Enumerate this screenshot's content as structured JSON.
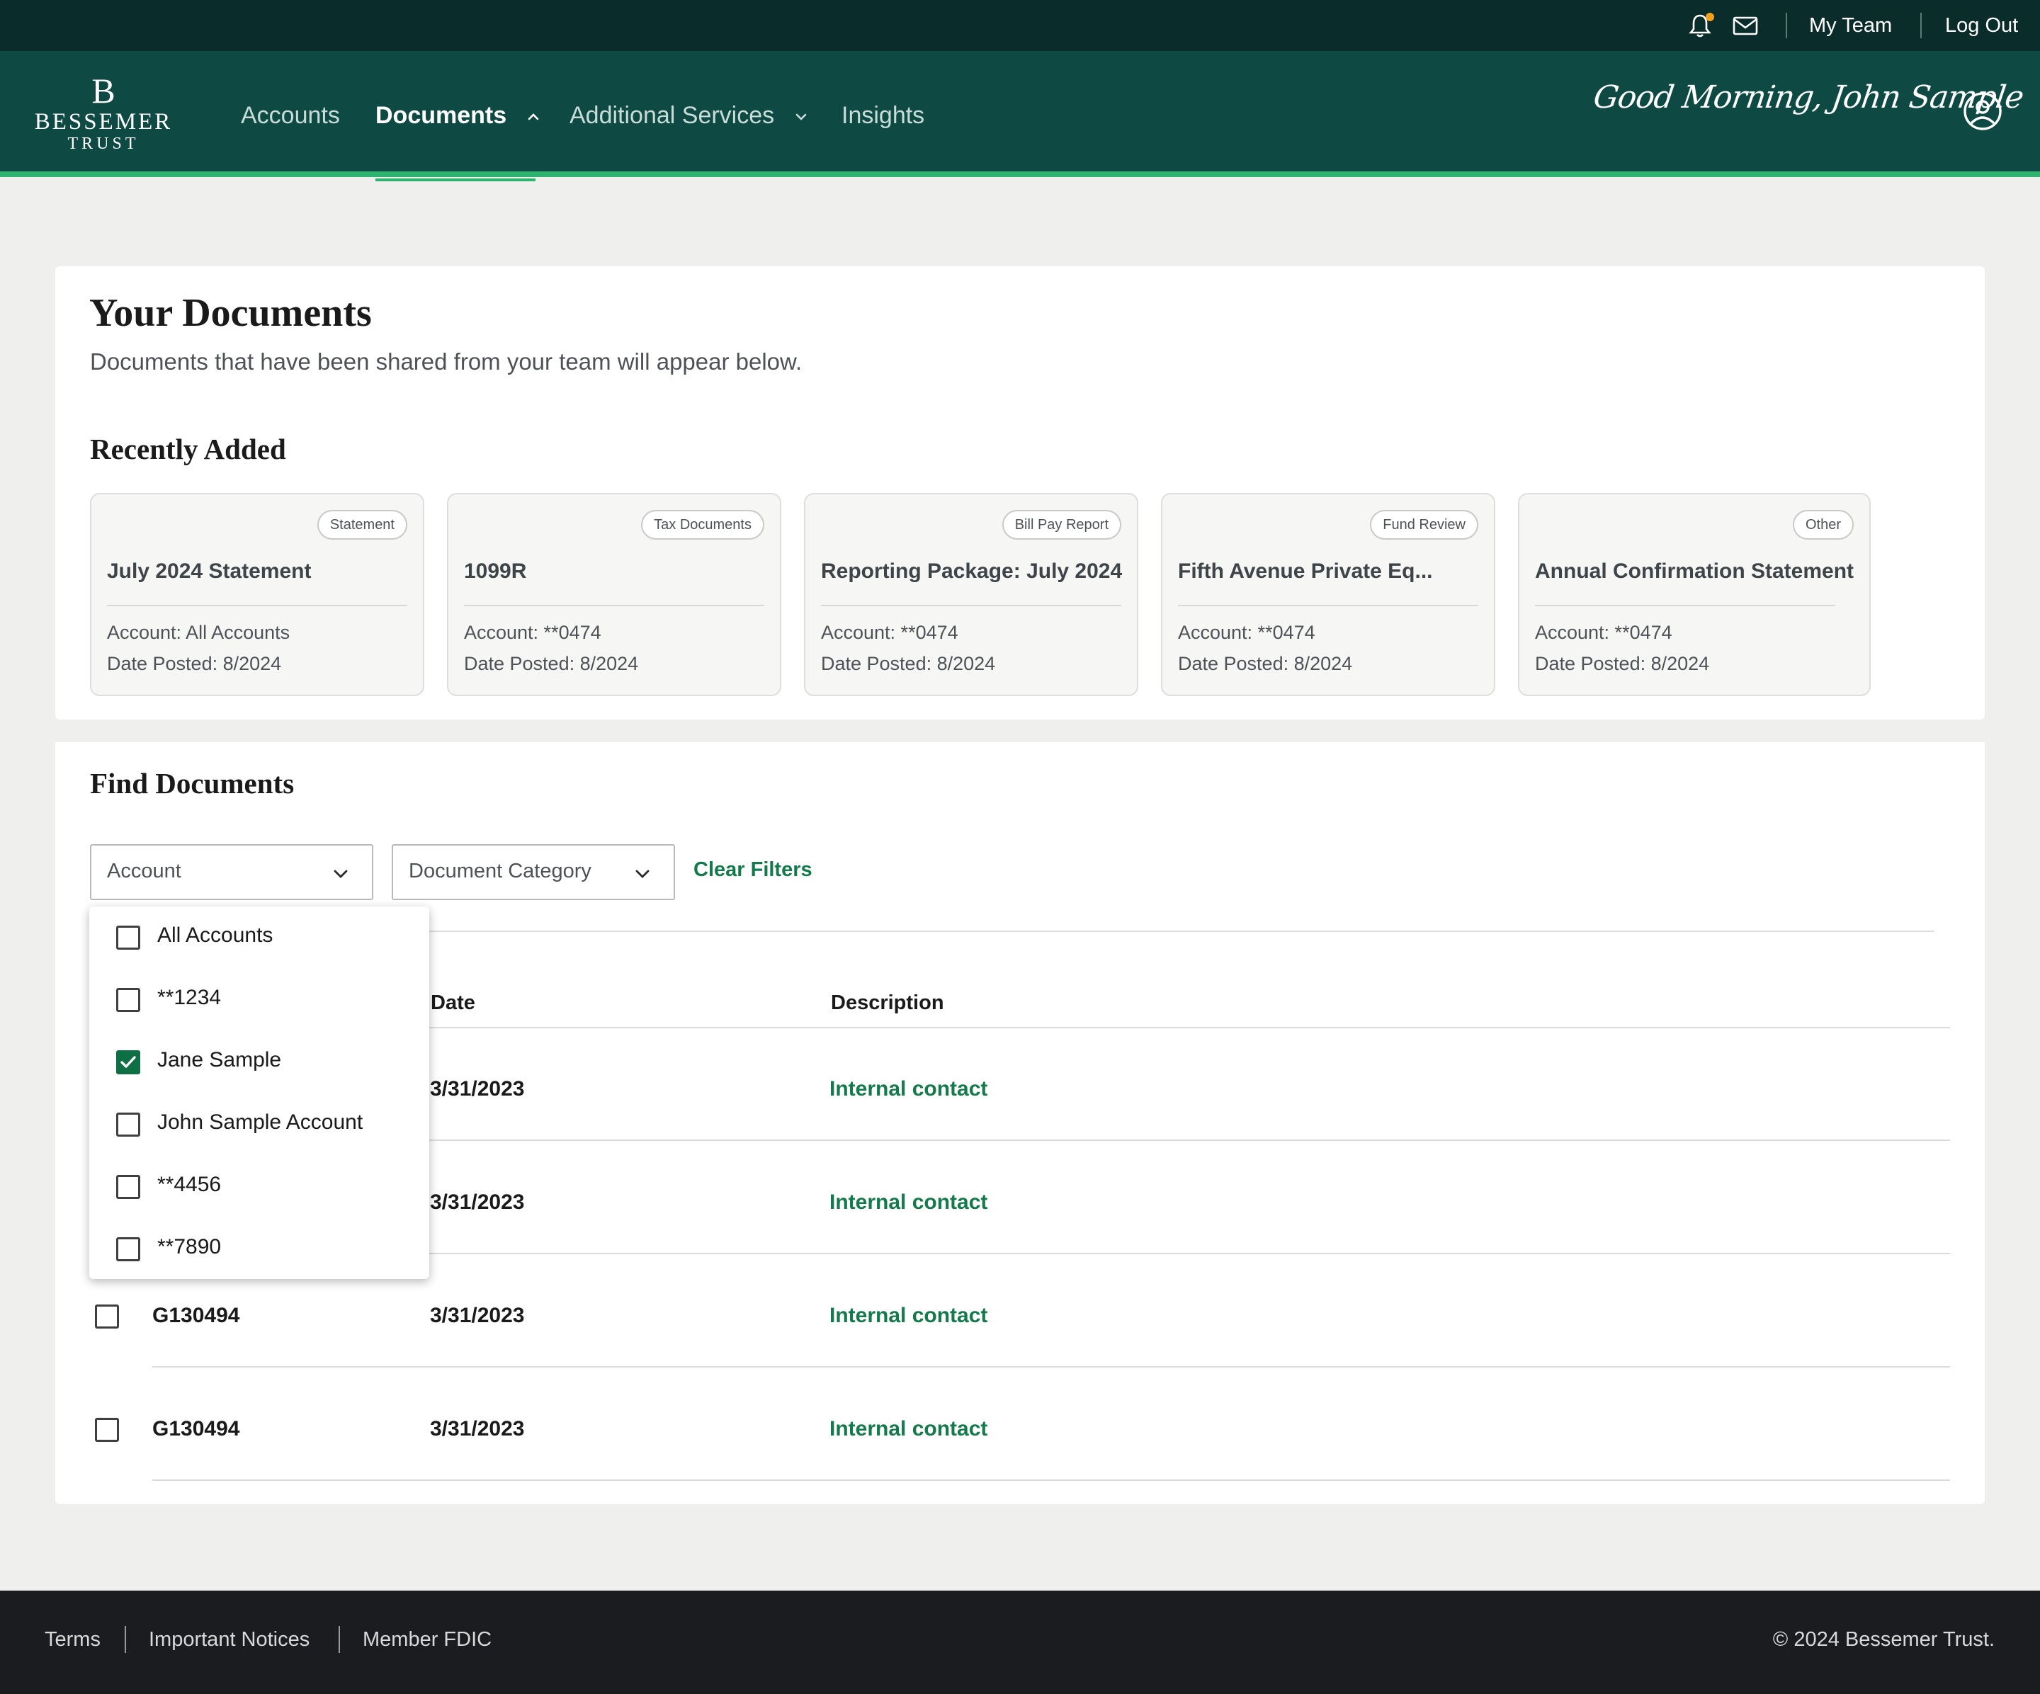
{
  "utility_bar": {
    "my_team": "My Team",
    "log_out": "Log Out"
  },
  "header": {
    "logo": {
      "mark": "B",
      "word1": "BESSEMER",
      "word2": "TRUST"
    },
    "nav": [
      {
        "label": "Accounts",
        "active": false
      },
      {
        "label": "Documents",
        "active": true,
        "expanded": true
      },
      {
        "label": "Additional Services",
        "active": false
      },
      {
        "label": "Insights",
        "active": false
      }
    ],
    "greeting": "Good Morning, John Sample"
  },
  "colors": {
    "utility_bg": "#0a2c2a",
    "header_bg": "#0e4a43",
    "accent_green": "#2eb36e",
    "link_green": "#137a4c",
    "checkbox_checked": "#0e6e44",
    "footer_bg": "#1b1c1f"
  },
  "icons": [
    "bell-icon",
    "mail-icon",
    "chevron-up-icon",
    "chevron-down-icon",
    "user-circle-icon",
    "check-icon"
  ],
  "your_documents": {
    "title": "Your Documents",
    "subtitle": "Documents that have been shared from your team will appear below.",
    "recently_added_title": "Recently Added",
    "cards": [
      {
        "badge": "Statement",
        "title": "July 2024 Statement",
        "account": "Account: All Accounts",
        "date": "Date Posted: 8/2024"
      },
      {
        "badge": "Tax Documents",
        "title": "1099R",
        "account": "Account: **0474",
        "date": "Date Posted: 8/2024"
      },
      {
        "badge": "Bill Pay Report",
        "title": "Reporting Package: July 2024",
        "account": "Account: **0474",
        "date": "Date Posted: 8/2024"
      },
      {
        "badge": "Fund Review",
        "title": "Fifth Avenue Private Eq...",
        "account": "Account: **0474",
        "date": "Date Posted: 8/2024"
      },
      {
        "badge": "Other",
        "title": "Annual Confirmation Statement",
        "account": "Account: **0474",
        "date": "Date Posted: 8/2024"
      }
    ]
  },
  "find_documents": {
    "title": "Find Documents",
    "filters": {
      "account_label": "Account",
      "category_label": "Document Category",
      "clear_label": "Clear Filters"
    },
    "account_dropdown": [
      {
        "label": "All Accounts",
        "checked": false
      },
      {
        "label": "**1234",
        "checked": false
      },
      {
        "label": "Jane Sample",
        "checked": true
      },
      {
        "label": "John Sample Account",
        "checked": false
      },
      {
        "label": "**4456",
        "checked": false
      },
      {
        "label": "**7890",
        "checked": false
      }
    ],
    "table": {
      "columns": [
        "Date",
        "Description"
      ],
      "rows": [
        {
          "account": "",
          "date": "3/31/2023",
          "description": "Internal contact"
        },
        {
          "account": "",
          "date": "3/31/2023",
          "description": "Internal contact"
        },
        {
          "account": "G130494",
          "date": "3/31/2023",
          "description": "Internal contact"
        },
        {
          "account": "G130494",
          "date": "3/31/2023",
          "description": "Internal contact"
        }
      ]
    }
  },
  "footer": {
    "links": [
      "Terms",
      "Important Notices",
      "Member FDIC"
    ],
    "copyright": "© 2024 Bessemer Trust."
  }
}
